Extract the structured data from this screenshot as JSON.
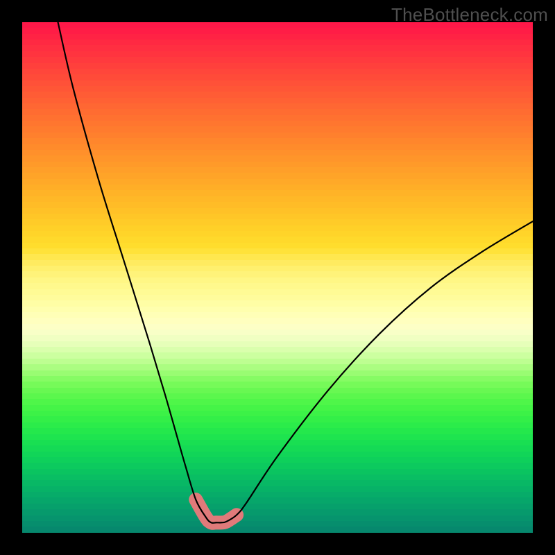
{
  "watermark": "TheBottleneck.com",
  "chart_data": {
    "type": "line",
    "title": "",
    "xlabel": "",
    "ylabel": "",
    "xlim": [
      0,
      100
    ],
    "ylim": [
      0,
      100
    ],
    "series": [
      {
        "name": "bottleneck-curve",
        "x": [
          7,
          10,
          15,
          20,
          25,
          28,
          30,
          32,
          34,
          36,
          37,
          38,
          39,
          40,
          42,
          44,
          50,
          60,
          70,
          80,
          90,
          100
        ],
        "y": [
          100,
          87,
          69,
          53,
          37,
          27,
          20,
          13,
          6.5,
          3,
          2,
          2,
          2,
          2.2,
          3.5,
          6,
          15,
          28,
          39,
          48,
          55,
          61
        ]
      }
    ],
    "highlight_band": {
      "x_start": 34,
      "x_end": 43,
      "name": "optimal-range",
      "color": "#e07a7a"
    },
    "gradient_colors": [
      "#ff1848",
      "#ff1d46",
      "#ff2344",
      "#ff2942",
      "#ff2f41",
      "#ff343f",
      "#ff3a3e",
      "#ff403c",
      "#ff463b",
      "#ff4b39",
      "#ff5138",
      "#ff5636",
      "#ff5c35",
      "#ff6134",
      "#ff6733",
      "#ff6c31",
      "#ff7130",
      "#ff762f",
      "#ff7b2e",
      "#ff802d",
      "#ff862c",
      "#ff8b2b",
      "#ff902b",
      "#ff952a",
      "#ff9a29",
      "#ff9f29",
      "#ffa428",
      "#ffa928",
      "#ffae27",
      "#ffb327",
      "#ffb827",
      "#ffbc27",
      "#ffc127",
      "#ffc627",
      "#ffcb28",
      "#ffd028",
      "#ffd429",
      "#ffd92b",
      "#ffdd2d",
      "#ffe23a",
      "#ffe74f",
      "#ffeb60",
      "#fff06e",
      "#fff37a",
      "#fff785",
      "#fff98d",
      "#fffb95",
      "#fffc9c",
      "#fffea5",
      "#ffffae",
      "#ffffb7",
      "#ffffbf",
      "#fdffc6",
      "#f8ffc7",
      "#f0ffc2",
      "#e6ffb9",
      "#daffad",
      "#ccffa0",
      "#bdfe91",
      "#abfd81",
      "#99fc72",
      "#86fb64",
      "#76fa59",
      "#68f852",
      "#5bf74d",
      "#4ff649",
      "#45f447",
      "#3cf247",
      "#33ef48",
      "#2bec4a",
      "#24e84c",
      "#1ee44f",
      "#19df52",
      "#15da55",
      "#11d558",
      "#0ed05b",
      "#0cca5e",
      "#0ac460",
      "#09be63",
      "#08b865",
      "#07b267",
      "#07ac69",
      "#06a66a",
      "#06a06b",
      "#069a6c",
      "#06946d",
      "#068e6d",
      "#06886d"
    ]
  }
}
